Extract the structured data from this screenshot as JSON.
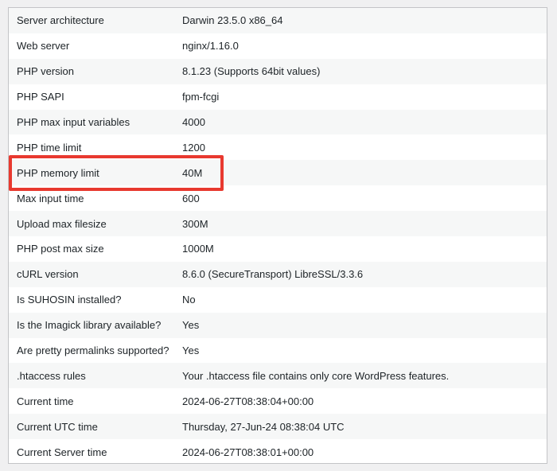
{
  "colors": {
    "highlight_border": "#e8392f",
    "row_alt_background": "#f6f7f7",
    "text": "#1d2327"
  },
  "server_info": {
    "rows": [
      {
        "label": "Server architecture",
        "value": "Darwin 23.5.0 x86_64"
      },
      {
        "label": "Web server",
        "value": "nginx/1.16.0"
      },
      {
        "label": "PHP version",
        "value": "8.1.23 (Supports 64bit values)"
      },
      {
        "label": "PHP SAPI",
        "value": "fpm-fcgi"
      },
      {
        "label": "PHP max input variables",
        "value": "4000"
      },
      {
        "label": "PHP time limit",
        "value": "1200"
      },
      {
        "label": "PHP memory limit",
        "value": "40M"
      },
      {
        "label": "Max input time",
        "value": "600"
      },
      {
        "label": "Upload max filesize",
        "value": "300M"
      },
      {
        "label": "PHP post max size",
        "value": "1000M"
      },
      {
        "label": "cURL version",
        "value": "8.6.0 (SecureTransport) LibreSSL/3.3.6"
      },
      {
        "label": "Is SUHOSIN installed?",
        "value": "No"
      },
      {
        "label": "Is the Imagick library available?",
        "value": "Yes"
      },
      {
        "label": "Are pretty permalinks supported?",
        "value": "Yes"
      },
      {
        "label": ".htaccess rules",
        "value": "Your .htaccess file contains only core WordPress features."
      },
      {
        "label": "Current time",
        "value": "2024-06-27T08:38:04+00:00"
      },
      {
        "label": "Current UTC time",
        "value": "Thursday, 27-Jun-24 08:38:04 UTC"
      },
      {
        "label": "Current Server time",
        "value": "2024-06-27T08:38:01+00:00"
      }
    ]
  }
}
